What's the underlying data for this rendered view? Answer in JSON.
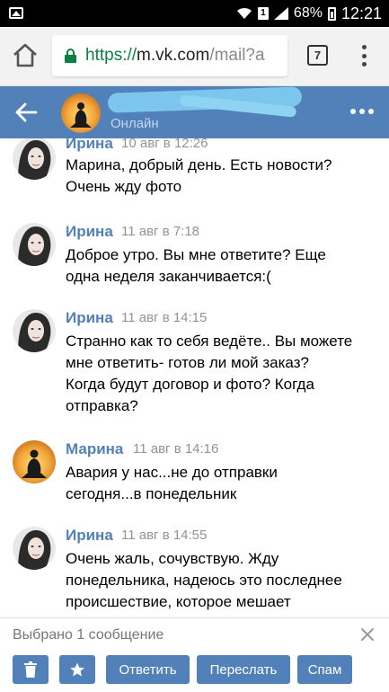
{
  "statusbar": {
    "sim_label": "1",
    "battery": "68%",
    "time": "12:21"
  },
  "browser": {
    "url_scheme": "https://",
    "url_host": "m.vk.com",
    "url_path": "/mail?a",
    "tab_count": "7"
  },
  "chat": {
    "status": "Онлайн",
    "accent_color": "#5181b8"
  },
  "messages": [
    {
      "author": "Ирина",
      "time": "10 авг в 12:26",
      "lines": [
        "Марина, добрый день. Есть новости?",
        "Очень жду фото"
      ],
      "avatar": "woman-portrait"
    },
    {
      "author": "Ирина",
      "time": "11 авг в 7:18",
      "lines": [
        "Доброе утро. Вы мне ответите? Еще",
        "одна неделя заканчивается:("
      ],
      "avatar": "woman-portrait"
    },
    {
      "author": "Ирина",
      "time": "11 авг в 14:15",
      "lines": [
        "Странно как то себя ведёте.. Вы можете",
        "мне ответить- готов ли мой заказ?",
        "Когда будут договор и фото? Когда",
        "отправка?"
      ],
      "avatar": "woman-portrait"
    },
    {
      "author": "Марина",
      "time": "11 авг в 14:16",
      "lines": [
        "Авария у нас...не до отправки",
        "сегодня...в понедельник"
      ],
      "avatar": "meditation-silhouette"
    },
    {
      "author": "Ирина",
      "time": "11 авг в 14:55",
      "lines": [
        "Очень жаль, сочувствую. Жду",
        "понедельника, надеюсь это последнее",
        "происшествие, которое мешает"
      ],
      "avatar": "woman-portrait"
    }
  ],
  "footer": {
    "selected_label": "Выбрано 1 сообщение",
    "reply_label": "Ответить",
    "forward_label": "Переслать",
    "spam_label": "Спам"
  }
}
